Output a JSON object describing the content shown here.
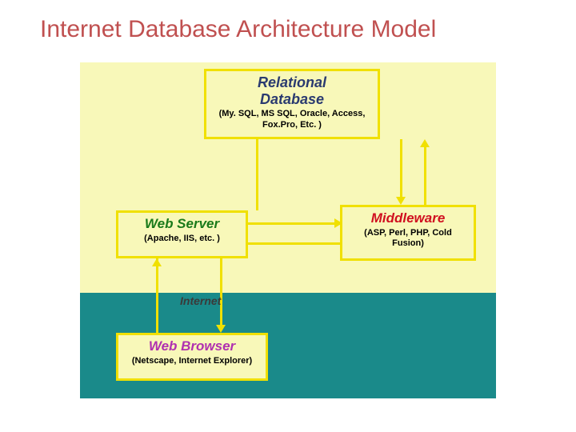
{
  "title": "Internet Database Architecture Model",
  "diagram": {
    "database": {
      "title_line1": "Relational",
      "title_line2": "Database",
      "subtitle": "(My. SQL, MS SQL, Oracle, Access, Fox.Pro, Etc. )"
    },
    "webserver": {
      "title": "Web Server",
      "subtitle": "(Apache, IIS, etc. )"
    },
    "middleware": {
      "title": "Middleware",
      "subtitle": "(ASP, Perl, PHP, Cold Fusion)"
    },
    "browser": {
      "title": "Web Browser",
      "subtitle": "(Netscape, Internet Explorer)"
    },
    "internet_label": "Internet"
  }
}
